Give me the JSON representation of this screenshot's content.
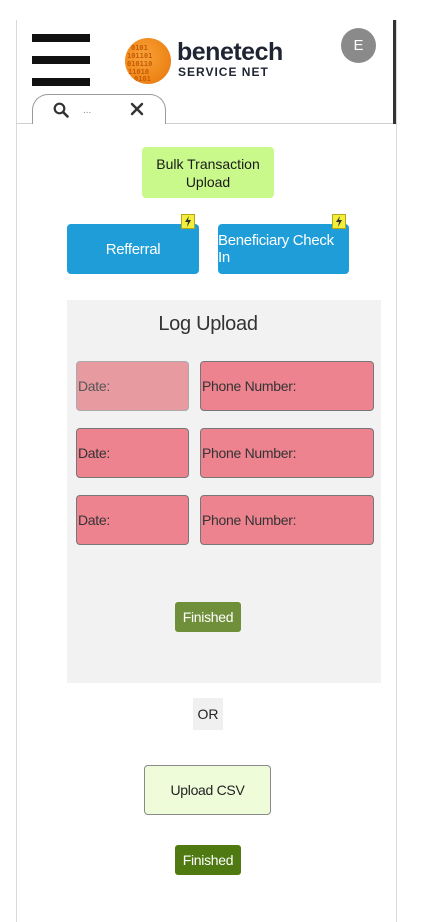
{
  "header": {
    "brand_name": "benetech",
    "brand_tagline": "SERVICE NET",
    "avatar_initial": "E",
    "search": {
      "placeholder": "...",
      "value": ""
    }
  },
  "actions": {
    "bulk_upload_label": "Bulk Transaction Upload",
    "referral_label": "Refferral",
    "checkin_label": "Beneficiary Check In"
  },
  "log_upload": {
    "title": "Log Upload",
    "rows": [
      {
        "date_label": "Date:",
        "phone_label": "Phone Number:"
      },
      {
        "date_label": "Date:",
        "phone_label": "Phone Number:"
      },
      {
        "date_label": "Date:",
        "phone_label": "Phone Number:"
      }
    ],
    "finished_label": "Finished"
  },
  "alternative": {
    "or_label": "OR",
    "upload_csv_label": "Upload CSV",
    "finished_label": "Finished"
  },
  "colors": {
    "bulk_button": "#c9f98a",
    "blue_button": "#1e9dd8",
    "field_pink": "#ee8390",
    "finished_green": "#4f7a12",
    "badge_yellow": "#f2ee3a"
  },
  "icons": {
    "menu": "hamburger-menu-icon",
    "search": "search-icon",
    "clear": "close-icon",
    "badge": "lightning-bolt-icon"
  }
}
